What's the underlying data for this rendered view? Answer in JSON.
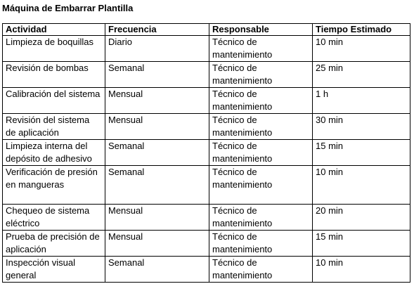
{
  "title": "Máquina de Embarrar Plantilla",
  "table": {
    "headers": [
      "Actividad",
      "Frecuencia",
      "Responsable",
      "Tiempo Estimado"
    ],
    "rows": [
      {
        "actividad": "Limpieza de boquillas",
        "frecuencia": "Diario",
        "responsable": "Técnico de mantenimiento",
        "tiempo": "10 min"
      },
      {
        "actividad": "Revisión de bombas",
        "frecuencia": "Semanal",
        "responsable": "Técnico de mantenimiento",
        "tiempo": "25 min"
      },
      {
        "actividad": "Calibración del sistema",
        "frecuencia": "Mensual",
        "responsable": "Técnico de mantenimiento",
        "tiempo": "1 h"
      },
      {
        "actividad": "Revisión del sistema de aplicación",
        "frecuencia": "Mensual",
        "responsable": "Técnico de mantenimiento",
        "tiempo": "30 min"
      },
      {
        "actividad": "Limpieza interna del depósito de adhesivo",
        "frecuencia": "Semanal",
        "responsable": "Técnico de mantenimiento",
        "tiempo": "15 min"
      },
      {
        "actividad": "Verificación de presión en mangueras",
        "frecuencia": "Semanal",
        "responsable": "Técnico de mantenimiento",
        "tiempo": "10 min"
      },
      {
        "actividad": "Chequeo de sistema eléctrico",
        "frecuencia": "Mensual",
        "responsable": "Técnico de mantenimiento",
        "tiempo": "20 min"
      },
      {
        "actividad": "Prueba de precisión de aplicación",
        "frecuencia": "Mensual",
        "responsable": "Técnico de mantenimiento",
        "tiempo": "15 min"
      },
      {
        "actividad": "Inspección visual general",
        "frecuencia": "Semanal",
        "responsable": "Técnico de mantenimiento",
        "tiempo": "10 min"
      }
    ]
  }
}
